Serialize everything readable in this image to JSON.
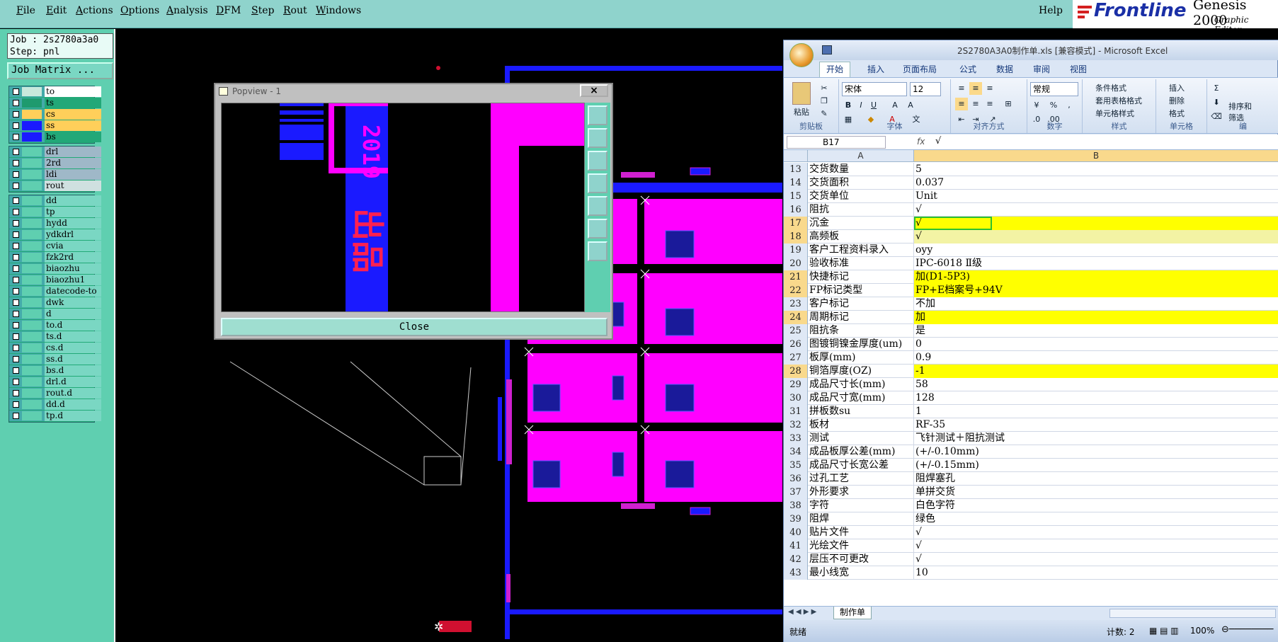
{
  "menubar": {
    "items": [
      "File",
      "Edit",
      "Actions",
      "Options",
      "Analysis",
      "DFM",
      "Step",
      "Rout",
      "Windows"
    ],
    "help": "Help",
    "logo_brand": "Frontline",
    "logo_product": "Genesis 2000",
    "logo_sub": "Graphic Editor"
  },
  "left": {
    "job_line": "Job : 2s2780a3a0",
    "step_line": "Step: pnl",
    "job_matrix_label": "Job Matrix ...",
    "layers_group1": [
      {
        "name": "to",
        "swatch": "#c8e8dc",
        "label_bg": "#ffffff"
      },
      {
        "name": "ts",
        "swatch": "#1e9a6e",
        "label_bg": "#22a878"
      },
      {
        "name": "cs",
        "swatch": "#ffcf5a",
        "label_bg": "#ffcf5a"
      },
      {
        "name": "ss",
        "swatch": "#1a1aff",
        "label_bg": "#ffcf5a"
      },
      {
        "name": "bs",
        "swatch": "#1a1aff",
        "label_bg": "#22a878"
      }
    ],
    "layers_group2": [
      {
        "name": "drl",
        "label_bg": "#9fb8c8"
      },
      {
        "name": "2rd",
        "label_bg": "#9fb8c8"
      },
      {
        "name": "ldi",
        "label_bg": "#9fb8c8"
      },
      {
        "name": "rout",
        "label_bg": "#cfe0e0"
      }
    ],
    "layers_group3": [
      "dd",
      "tp",
      "hydd",
      "ydkdrl",
      "cvia",
      "fzk2rd",
      "biaozhu",
      "biaozhu1",
      "datecode-to",
      "dwk",
      "d",
      "to.d",
      "ts.d",
      "cs.d",
      "ss.d",
      "bs.d",
      "drl.d",
      "rout.d",
      "dd.d",
      "tp.d"
    ]
  },
  "popview": {
    "title": "Popview - 1",
    "close_x": "×",
    "close_label": "Close"
  },
  "excel": {
    "title": "2S2780A3A0制作单.xls [兼容模式] - Microsoft Excel",
    "tabs": [
      "开始",
      "插入",
      "页面布局",
      "公式",
      "数据",
      "审阅",
      "视图"
    ],
    "ribbon": {
      "paste": "粘贴",
      "clipboard": "剪贴板",
      "font_name": "宋体",
      "font_size": "12",
      "font_group": "字体",
      "align_group": "对齐方式",
      "number_format": "常规",
      "number_group": "数字",
      "cond_format": "条件格式",
      "table_format": "套用表格格式",
      "cell_style": "单元格样式",
      "style_group": "样式",
      "insert": "插入",
      "delete": "删除",
      "format": "格式",
      "cells_group": "单元格",
      "sort": "排序和",
      "filter": "筛选",
      "edit_group": "编"
    },
    "name_box": "B17",
    "formula": "√",
    "col_a": "A",
    "col_b": "B",
    "rows": [
      {
        "n": "13",
        "a": "交货数量",
        "b": "5",
        "hl": ""
      },
      {
        "n": "14",
        "a": "交货面积",
        "b": "0.037",
        "hl": ""
      },
      {
        "n": "15",
        "a": "交货单位",
        "b": "Unit",
        "hl": ""
      },
      {
        "n": "16",
        "a": "阻抗",
        "b": "√",
        "hl": ""
      },
      {
        "n": "17",
        "a": "沉金",
        "b": "√",
        "hl": "yel"
      },
      {
        "n": "18",
        "a": "高频板",
        "b": "√",
        "hl": "ylt"
      },
      {
        "n": "19",
        "a": "客户工程资料录入",
        "b": "oyy",
        "hl": ""
      },
      {
        "n": "20",
        "a": "验收标准",
        "b": "IPC-6018 Ⅱ级",
        "hl": ""
      },
      {
        "n": "21",
        "a": "快捷标记",
        "b": "加(D1-5P3)",
        "hl": "yel"
      },
      {
        "n": "22",
        "a": "FP标记类型",
        "b": "FP+E档案号+94V",
        "hl": "yel"
      },
      {
        "n": "23",
        "a": "客户标记",
        "b": "不加",
        "hl": ""
      },
      {
        "n": "24",
        "a": "周期标记",
        "b": "加",
        "hl": "yel"
      },
      {
        "n": "25",
        "a": "阻抗条",
        "b": "是",
        "hl": ""
      },
      {
        "n": "26",
        "a": "图镀铜镍金厚度(um)",
        "b": "0",
        "hl": ""
      },
      {
        "n": "27",
        "a": "板厚(mm)",
        "b": "0.9",
        "hl": ""
      },
      {
        "n": "28",
        "a": "铜箔厚度(OZ)",
        "b": "-1",
        "hl": "yel"
      },
      {
        "n": "29",
        "a": "成品尺寸长(mm)",
        "b": "58",
        "hl": ""
      },
      {
        "n": "30",
        "a": "成品尺寸宽(mm)",
        "b": "128",
        "hl": ""
      },
      {
        "n": "31",
        "a": "拼板数su",
        "b": "1",
        "hl": ""
      },
      {
        "n": "32",
        "a": "板材",
        "b": "RF-35",
        "hl": ""
      },
      {
        "n": "33",
        "a": "测试",
        "b": "飞针测试＋阻抗测试",
        "hl": ""
      },
      {
        "n": "34",
        "a": "成品板厚公差(mm)",
        "b": "(+/-0.10mm)",
        "hl": ""
      },
      {
        "n": "35",
        "a": "成品尺寸长宽公差",
        "b": "(+/-0.15mm)",
        "hl": ""
      },
      {
        "n": "36",
        "a": "过孔工艺",
        "b": "阻焊塞孔",
        "hl": ""
      },
      {
        "n": "37",
        "a": "外形要求",
        "b": "单拼交货",
        "hl": ""
      },
      {
        "n": "38",
        "a": "字符",
        "b": "白色字符",
        "hl": ""
      },
      {
        "n": "39",
        "a": "阻焊",
        "b": "绿色",
        "hl": ""
      },
      {
        "n": "40",
        "a": "贴片文件",
        "b": "√",
        "hl": ""
      },
      {
        "n": "41",
        "a": "光绘文件",
        "b": "√",
        "hl": ""
      },
      {
        "n": "42",
        "a": "层压不可更改",
        "b": "√",
        "hl": ""
      },
      {
        "n": "43",
        "a": "最小线宽",
        "b": "10",
        "hl": ""
      }
    ],
    "sheet_tab": "制作单",
    "status_ready": "就绪",
    "status_count": "计数: 2",
    "zoom": "100%"
  }
}
